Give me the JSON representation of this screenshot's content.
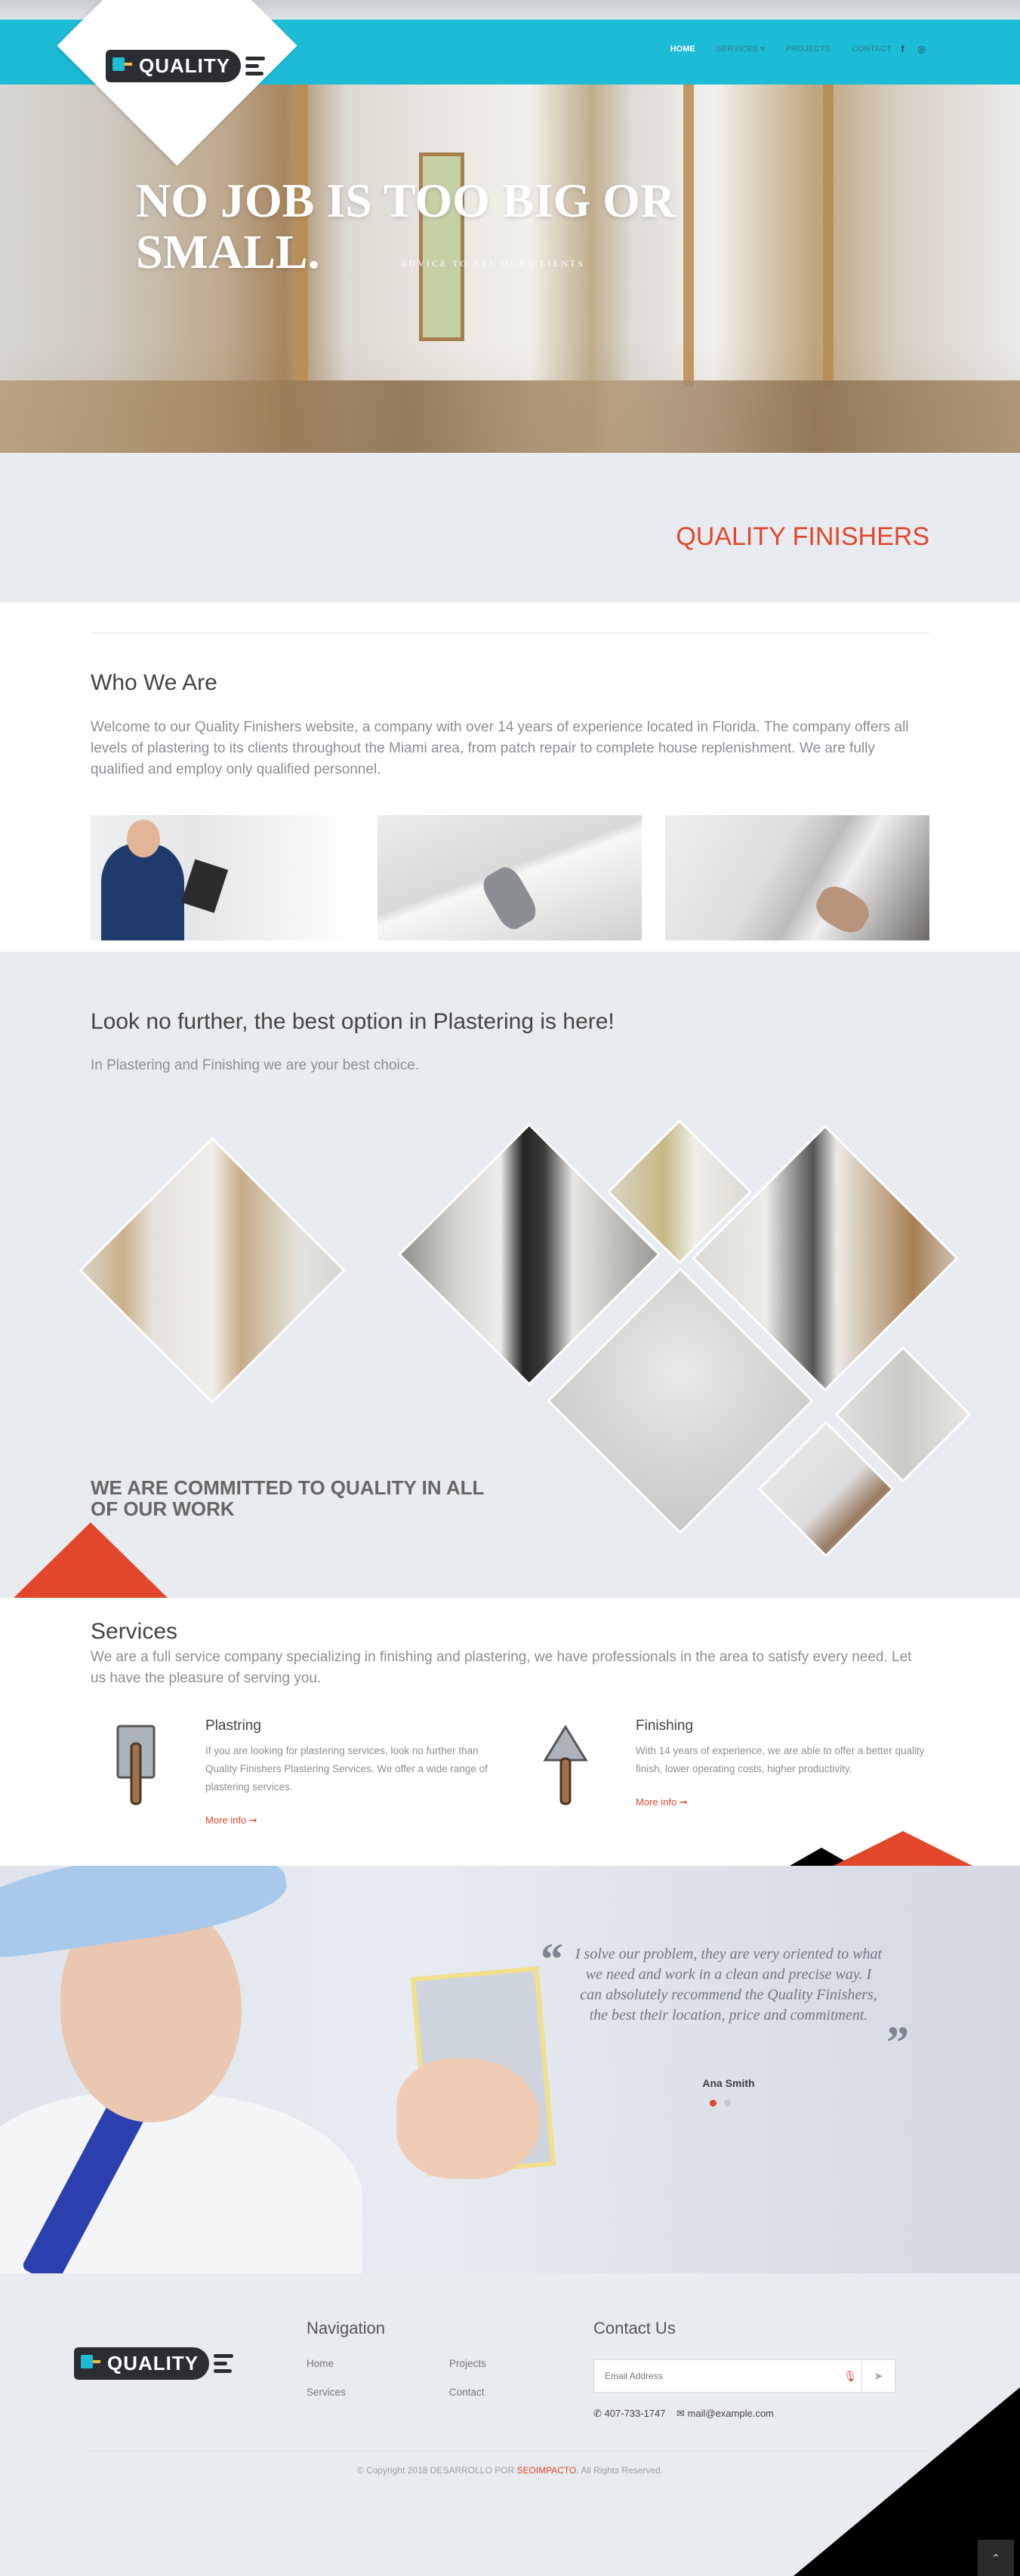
{
  "header": {
    "logo_text": "QUALITY",
    "nav": [
      {
        "label": "HOME"
      },
      {
        "label": "SERVICES ▾"
      },
      {
        "label": "PROJECTS"
      },
      {
        "label": "CONTACT"
      }
    ],
    "social": [
      "facebook-icon",
      "instagram-icon"
    ]
  },
  "hero": {
    "title": "NO JOB IS TOO BIG OR SMALL.",
    "subtitle": "ADVICE TO ALL OUR CLIENTS"
  },
  "band": {
    "title": "QUALITY FINISHERS"
  },
  "who": {
    "title": "Who We Are",
    "text": "Welcome to our Quality Finishers website, a company with over 14 years of experience located in Florida. The company offers all levels of plastering to its clients throughout the Miami area, from patch repair to complete house replenishment. We are fully qualified and employ only qualified personnel."
  },
  "gallery": {
    "title": "Look no further, the best option in Plastering is here!",
    "subtitle": "In Plastering and Finishing we are your best choice.",
    "commit": "WE ARE COMMITTED TO QUALITY IN ALL OF OUR WORK"
  },
  "services": {
    "title": "Services",
    "text": "We are a full service company specializing in finishing and plastering, we have professionals in the area to satisfy every need. Let us have the pleasure of serving you.",
    "items": [
      {
        "title": "Plastring",
        "text": "If you are looking for plastering services, look no further than Quality Finishers Plastering Services. We offer a wide range of plastering services.",
        "more": "More info ➞"
      },
      {
        "title": "Finishing",
        "text": "With 14 years of experience, we are able to offer a better quality finish, lower operating costs, higher productivity.",
        "more": "More info ➞"
      }
    ]
  },
  "testimonial": {
    "quote": "I solve our problem, they are very oriented to what we need and work in a clean and precise way. I can absolutely recommend the Quality Finishers, the best their location, price and commitment.",
    "author": "Ana Smith",
    "open_mark": "“",
    "close_mark": "”"
  },
  "footer": {
    "nav_title": "Navigation",
    "links": [
      "Home",
      "Projects",
      "Services",
      "Contact"
    ],
    "contact_title": "Contact Us",
    "email_placeholder": "Email Address",
    "phone": "407-733-1747",
    "email": "mail@example.com",
    "copyright_pre": "© Copyright 2018 DESARROLLO POR ",
    "copyright_brand": "SEOIMPACTO.",
    "copyright_post": " All Rights Reserved."
  },
  "colors": {
    "accent_cyan": "#1cbcd6",
    "accent_red": "#e2472c",
    "background_gray": "#e8ebef"
  }
}
